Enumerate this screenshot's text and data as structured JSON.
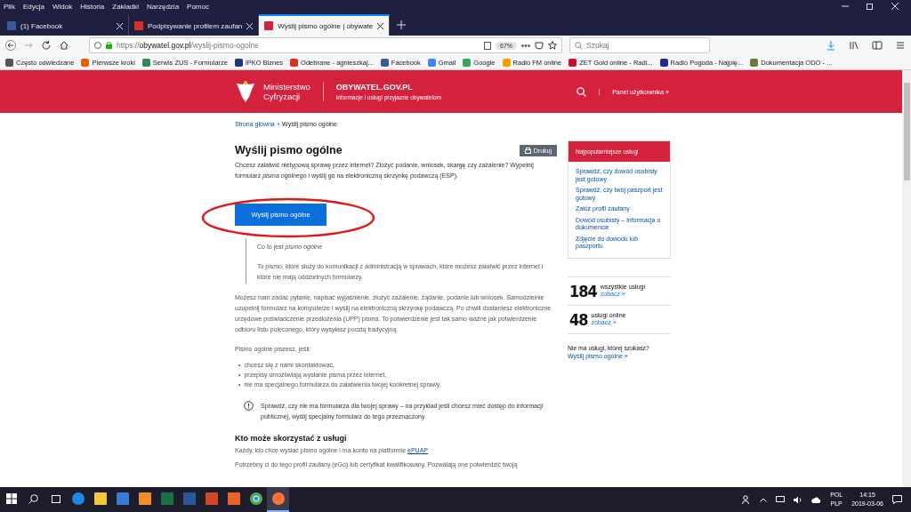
{
  "menu": [
    "Plik",
    "Edycja",
    "Widok",
    "Historia",
    "Zakładki",
    "Narzędzia",
    "Pomoc"
  ],
  "tabs": [
    {
      "label": "(1) Facebook",
      "selected": false
    },
    {
      "label": "Podpisywanie profilem zaufan",
      "selected": false
    },
    {
      "label": "Wyślij pismo ogólne | obywate",
      "selected": true
    }
  ],
  "address": {
    "url": "https://**obywatel.gov.pl**/wyslij-pismo-ogolne",
    "zoom": "67%"
  },
  "search": {
    "placeholder": "Szukaj"
  },
  "bookmarks": [
    {
      "label": "Często odwiedzane",
      "color": "#555555"
    },
    {
      "label": "Pierwsze kroki",
      "color": "#e66000"
    },
    {
      "label": "Serwis ZUS - Formularze",
      "color": "#2e8b57"
    },
    {
      "label": "iPKO Biznes",
      "color": "#1a3a7a"
    },
    {
      "label": "Odebrane - agnieszkaj...",
      "color": "#d93025"
    },
    {
      "label": "Facebook",
      "color": "#3b5998"
    },
    {
      "label": "Gmail",
      "color": "#4285f4"
    },
    {
      "label": "Google",
      "color": "#34a853"
    },
    {
      "label": "Radio FM online",
      "color": "#f4a000"
    },
    {
      "label": "ZET Gold online - Radi...",
      "color": "#c8102e"
    },
    {
      "label": "Radio Pogoda - Najpię...",
      "color": "#2a2a8a"
    },
    {
      "label": "Dokumentacja ODO - ...",
      "color": "#6b7a3a"
    }
  ],
  "header": {
    "ministry": [
      "Ministerstwo",
      "Cyfryzacji"
    ],
    "site_title": "OBYWATEL.GOV.PL",
    "site_subtitle": "informacje i usługi przyjazne obywatelom",
    "panel_link": "Panel użytkownika »"
  },
  "breadcrumb_separator": "›",
  "breadcrumb": [
    {
      "label": "Strona główna",
      "link": true
    },
    {
      "label": "Wyślij pismo ogólne",
      "link": false
    }
  ],
  "main": {
    "title": "Wyślij pismo ogólne",
    "print_button": "Drukuj",
    "intro": "Chcesz załatwić nietypową sprawę przez internet? Złożyć podanie, wniosek, skargę czy zażalenie? Wypełnij formularz *pisma ogólnego* i wyślij go na elektroniczną skrzynkę podawczą (ESP).",
    "cta_button": "Wyślij pismo ogólne",
    "quote_title": "Co to jest *pismo ogólne*",
    "quote_text": "To pismo, które służy do komunikacji z administracją w sprawach, które możesz załatwić przez internet i które nie mają oddzielnych formularzy.",
    "paragraph": "Możesz nam zadać pytanie, napisać wyjaśnienie, złożyć zażalenie, żądanie, podanie lub wniosek. Samodzielnie uzupełnij formularz na komputerze i wyślij na elektroniczną skrzynkę podawczą. Po chwili dostaniesz elektroniczne urzędowe poświadczenie przedłożenia (UPP) pisma. To potwierdzenie jest tak samo ważne jak potwierdzenie odbioru listu poleconego, który wysyłasz pocztą tradycyjną.",
    "list_intro": "Pismo ogólne piszesz, jeśli:",
    "bullet_marker": "•",
    "bullets": [
      "chcesz się z nami skontaktować,",
      "przepisy umożliwiają wysłanie pisma przez internet,",
      "nie ma specjalnego formularza do załatwienia twojej konkretnej sprawy."
    ],
    "notice": "Sprawdź, czy nie ma formularza dla twojej sprawy – na przykład jeśli chcesz mieć dostęp do informacji publicznej, wyślij specjalny formularz do tego przeznaczony.",
    "section_title": "Kto może skorzystać z usługi",
    "who_text": "Każdy, kto chce wysłać pismo ogólne i ma konto na platformie",
    "who_link": "ePUAP",
    "last_line": "Potrzebny ci do tego profil zaufany (eGo) lub certyfikat kwalifikowany. Pozwalają one potwierdzić twoją"
  },
  "sidebar": {
    "popular_title": "Najpopularniejsze usługi",
    "links": [
      "Sprawdź, czy dowód osobisty jest gotowy",
      "Sprawdź, czy twój paszport jest gotowy",
      "Załóż profil zaufany",
      "Dowód osobisty – informacja o dokumencie",
      "Zdjęcie do dowodu lub paszportu"
    ],
    "stats": [
      {
        "number": "184",
        "label": "wszystkie usługi",
        "link": "zobacz »"
      },
      {
        "number": "48",
        "label": "usługi online",
        "link": "zobacz »"
      }
    ],
    "question": "Nie ma usługi, której szukasz?",
    "question_link": "Wyślij pismo ogólne »"
  },
  "taskbar": {
    "apps": [
      {
        "kind": "edge",
        "active": false
      },
      {
        "kind": "folder",
        "active": false
      },
      {
        "kind": "store",
        "active": false
      },
      {
        "kind": "media",
        "active": false
      },
      {
        "kind": "excel",
        "active": false
      },
      {
        "kind": "word",
        "active": false
      },
      {
        "kind": "powerpoint",
        "active": false
      },
      {
        "kind": "slides",
        "active": false
      },
      {
        "kind": "chrome",
        "active": false
      },
      {
        "kind": "firefox",
        "active": true
      }
    ],
    "lang": [
      "POL",
      "PLP"
    ],
    "time": "14:15",
    "date": "2019-03-06"
  }
}
